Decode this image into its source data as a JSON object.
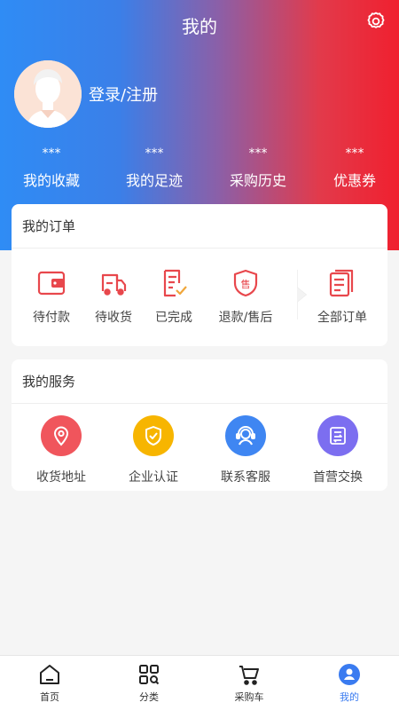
{
  "header": {
    "title": "我的"
  },
  "profile": {
    "login_text": "登录/注册"
  },
  "stats": [
    {
      "value": "***",
      "label": "我的收藏"
    },
    {
      "value": "***",
      "label": "我的足迹"
    },
    {
      "value": "***",
      "label": "采购历史"
    },
    {
      "value": "***",
      "label": "优惠券"
    }
  ],
  "orders": {
    "title": "我的订单",
    "items": [
      {
        "label": "待付款",
        "icon": "wallet-icon"
      },
      {
        "label": "待收货",
        "icon": "truck-icon"
      },
      {
        "label": "已完成",
        "icon": "completed-doc-icon"
      },
      {
        "label": "退款/售后",
        "icon": "after-sale-shield-icon"
      },
      {
        "label": "全部订单",
        "icon": "order-list-icon"
      }
    ]
  },
  "services": {
    "title": "我的服务",
    "items": [
      {
        "label": "收货地址",
        "icon": "location-pin-icon",
        "color": "#f0555c"
      },
      {
        "label": "企业认证",
        "icon": "verified-shield-icon",
        "color": "#f7b500"
      },
      {
        "label": "联系客服",
        "icon": "customer-service-icon",
        "color": "#3f86f2"
      },
      {
        "label": "首营交换",
        "icon": "exchange-doc-icon",
        "color": "#7c6ef0"
      }
    ]
  },
  "tabbar": {
    "active": "我的",
    "items": [
      {
        "label": "首页",
        "icon": "home-icon"
      },
      {
        "label": "分类",
        "icon": "category-icon"
      },
      {
        "label": "采购车",
        "icon": "cart-icon"
      },
      {
        "label": "我的",
        "icon": "profile-icon"
      }
    ]
  },
  "colors": {
    "accent": "#3a7bf0",
    "order_icon_red": "#e8474c",
    "gradient_left": "#2f8cf5",
    "gradient_right": "#f0202f"
  }
}
